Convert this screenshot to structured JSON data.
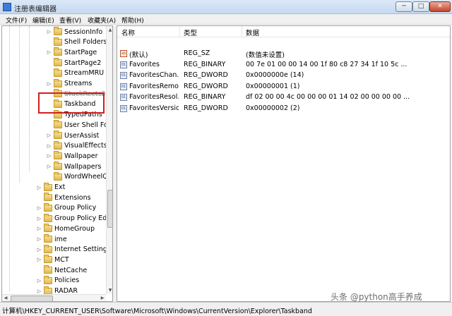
{
  "window": {
    "title": "注册表编辑器",
    "buttons": {
      "minimize": "─",
      "maximize": "□",
      "close": "✕"
    }
  },
  "menu": {
    "items": [
      "文件(F)",
      "编辑(E)",
      "查看(V)",
      "收藏夹(A)",
      "帮助(H)"
    ]
  },
  "tree": {
    "items": [
      {
        "label": "SessionInfo",
        "depth": 2,
        "expandable": true
      },
      {
        "label": "Shell Folders",
        "depth": 2,
        "expandable": false
      },
      {
        "label": "StartPage",
        "depth": 2,
        "expandable": true
      },
      {
        "label": "StartPage2",
        "depth": 2,
        "expandable": false
      },
      {
        "label": "StreamMRU",
        "depth": 2,
        "expandable": false
      },
      {
        "label": "Streams",
        "depth": 2,
        "expandable": true
      },
      {
        "label": "StuckRects2",
        "depth": 2,
        "expandable": false
      },
      {
        "label": "Taskband",
        "depth": 2,
        "expandable": false,
        "selected": true
      },
      {
        "label": "TypedPaths",
        "depth": 2,
        "expandable": false
      },
      {
        "label": "User Shell Fol",
        "depth": 2,
        "expandable": false
      },
      {
        "label": "UserAssist",
        "depth": 2,
        "expandable": true
      },
      {
        "label": "VisualEffects",
        "depth": 2,
        "expandable": true
      },
      {
        "label": "Wallpaper",
        "depth": 2,
        "expandable": true
      },
      {
        "label": "Wallpapers",
        "depth": 2,
        "expandable": true
      },
      {
        "label": "WordWheelQ",
        "depth": 2,
        "expandable": false
      },
      {
        "label": "Ext",
        "depth": 1,
        "expandable": true
      },
      {
        "label": "Extensions",
        "depth": 1,
        "expandable": false
      },
      {
        "label": "Group Policy",
        "depth": 1,
        "expandable": true
      },
      {
        "label": "Group Policy Edit",
        "depth": 1,
        "expandable": true
      },
      {
        "label": "HomeGroup",
        "depth": 1,
        "expandable": true
      },
      {
        "label": "ime",
        "depth": 1,
        "expandable": true
      },
      {
        "label": "Internet Settings",
        "depth": 1,
        "expandable": true
      },
      {
        "label": "MCT",
        "depth": 1,
        "expandable": true
      },
      {
        "label": "NetCache",
        "depth": 1,
        "expandable": false
      },
      {
        "label": "Policies",
        "depth": 1,
        "expandable": true
      },
      {
        "label": "RADAR",
        "depth": 1,
        "expandable": true
      }
    ]
  },
  "list": {
    "columns": [
      "名称",
      "类型",
      "数据"
    ],
    "rows": [
      {
        "name": "(默认)",
        "type": "REG_SZ",
        "data": "(数值未设置)",
        "icon": "ab"
      },
      {
        "name": "Favorites",
        "type": "REG_BINARY",
        "data": "00 7e 01 00 00 14 00 1f 80 c8 27 34 1f 10 5c ...",
        "icon": "bin"
      },
      {
        "name": "FavoritesChan...",
        "type": "REG_DWORD",
        "data": "0x0000000e (14)",
        "icon": "bin"
      },
      {
        "name": "FavoritesRemo...",
        "type": "REG_DWORD",
        "data": "0x00000001 (1)",
        "icon": "bin"
      },
      {
        "name": "FavoritesResol...",
        "type": "REG_BINARY",
        "data": "df 02 00 00 4c 00 00 00 01 14 02 00 00 00 00 ...",
        "icon": "bin"
      },
      {
        "name": "FavoritesVersion",
        "type": "REG_DWORD",
        "data": "0x00000002 (2)",
        "icon": "bin"
      }
    ]
  },
  "status": {
    "path": "计算机\\HKEY_CURRENT_USER\\Software\\Microsoft\\Windows\\CurrentVersion\\Explorer\\Taskband"
  },
  "watermark": "头条 @python高手养成",
  "colors": {
    "highlight_box": "#d02020",
    "folder": "#e0b94e"
  }
}
